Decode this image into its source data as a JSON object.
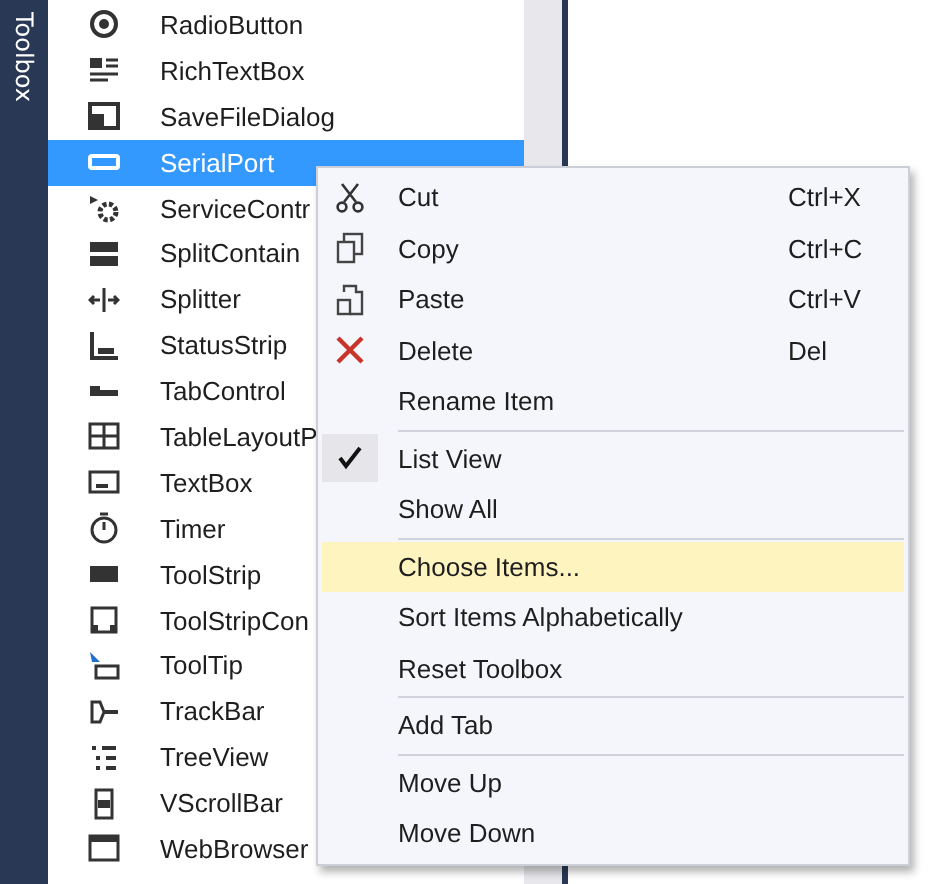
{
  "side_tab": {
    "label": "Toolbox"
  },
  "toolbox": {
    "items": [
      {
        "label": "RadioButton",
        "selected": false
      },
      {
        "label": "RichTextBox",
        "selected": false
      },
      {
        "label": "SaveFileDialog",
        "selected": false
      },
      {
        "label": "SerialPort",
        "selected": true
      },
      {
        "label": "ServiceContr",
        "selected": false
      },
      {
        "label": "SplitContain",
        "selected": false
      },
      {
        "label": "Splitter",
        "selected": false
      },
      {
        "label": "StatusStrip",
        "selected": false
      },
      {
        "label": "TabControl",
        "selected": false
      },
      {
        "label": "TableLayoutP",
        "selected": false
      },
      {
        "label": "TextBox",
        "selected": false
      },
      {
        "label": "Timer",
        "selected": false
      },
      {
        "label": "ToolStrip",
        "selected": false
      },
      {
        "label": "ToolStripCon",
        "selected": false
      },
      {
        "label": "ToolTip",
        "selected": false
      },
      {
        "label": "TrackBar",
        "selected": false
      },
      {
        "label": "TreeView",
        "selected": false
      },
      {
        "label": "VScrollBar",
        "selected": false
      },
      {
        "label": "WebBrowser",
        "selected": false
      }
    ]
  },
  "context_menu": {
    "items": [
      {
        "kind": "item",
        "label": "Cut",
        "shortcut": "Ctrl+X",
        "checked": false,
        "selected": false
      },
      {
        "kind": "item",
        "label": "Copy",
        "shortcut": "Ctrl+C",
        "checked": false,
        "selected": false
      },
      {
        "kind": "item",
        "label": "Paste",
        "shortcut": "Ctrl+V",
        "checked": false,
        "selected": false
      },
      {
        "kind": "item",
        "label": "Delete",
        "shortcut": "Del",
        "checked": false,
        "selected": false
      },
      {
        "kind": "item",
        "label": "Rename Item",
        "checked": false,
        "selected": false
      },
      {
        "kind": "separator"
      },
      {
        "kind": "item",
        "label": "List View",
        "checked": true,
        "selected": false
      },
      {
        "kind": "item",
        "label": "Show All",
        "checked": false,
        "selected": false
      },
      {
        "kind": "separator"
      },
      {
        "kind": "item",
        "label": "Choose Items...",
        "checked": false,
        "selected": true
      },
      {
        "kind": "item",
        "label": "Sort Items Alphabetically",
        "checked": false,
        "selected": false
      },
      {
        "kind": "item",
        "label": "Reset Toolbox",
        "checked": false,
        "selected": false
      },
      {
        "kind": "separator"
      },
      {
        "kind": "item",
        "label": "Add Tab",
        "checked": false,
        "selected": false
      },
      {
        "kind": "separator"
      },
      {
        "kind": "item",
        "label": "Move Up",
        "checked": false,
        "selected": false
      },
      {
        "kind": "item",
        "label": "Move Down",
        "checked": false,
        "selected": false
      }
    ]
  }
}
